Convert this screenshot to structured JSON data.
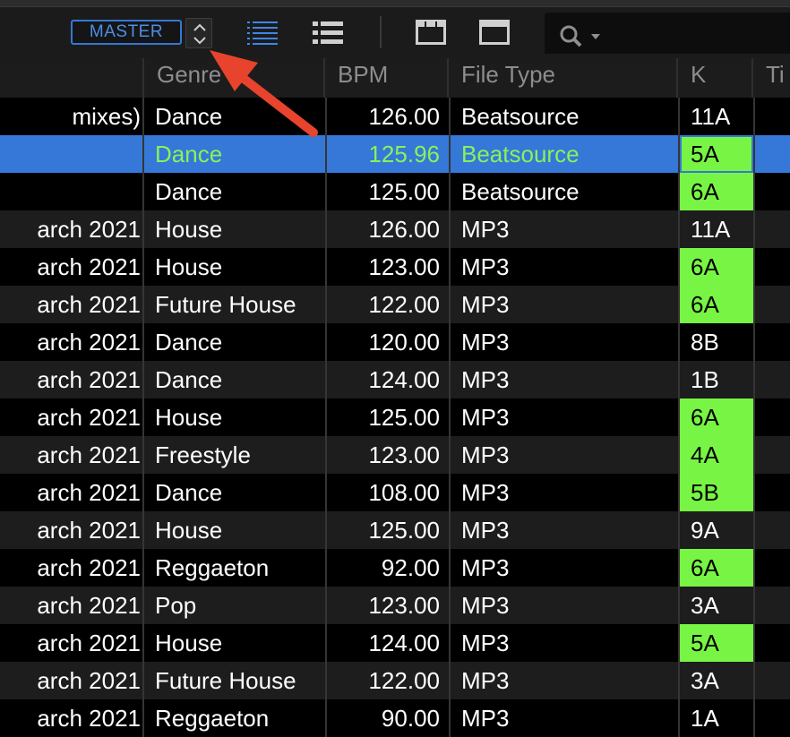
{
  "toolbar": {
    "master_label": "MASTER"
  },
  "columns": {
    "genre": "Genre",
    "bpm": "BPM",
    "file_type": "File Type",
    "key": "K",
    "time": "Ti"
  },
  "rows": [
    {
      "col0": "mixes)",
      "genre": "Dance",
      "bpm": "126.00",
      "type": "Beatsource",
      "key": "11A",
      "key_green": false,
      "selected": false
    },
    {
      "col0": "",
      "genre": "Dance",
      "bpm": "125.96",
      "type": "Beatsource",
      "key": "5A",
      "key_green": true,
      "selected": true
    },
    {
      "col0": "",
      "genre": "Dance",
      "bpm": "125.00",
      "type": "Beatsource",
      "key": "6A",
      "key_green": true,
      "selected": false
    },
    {
      "col0": "arch 2021",
      "genre": "House",
      "bpm": "126.00",
      "type": "MP3",
      "key": "11A",
      "key_green": false,
      "selected": false
    },
    {
      "col0": "arch 2021",
      "genre": "House",
      "bpm": "123.00",
      "type": "MP3",
      "key": "6A",
      "key_green": true,
      "selected": false
    },
    {
      "col0": "arch 2021",
      "genre": "Future House",
      "bpm": "122.00",
      "type": "MP3",
      "key": "6A",
      "key_green": true,
      "selected": false
    },
    {
      "col0": "arch 2021",
      "genre": "Dance",
      "bpm": "120.00",
      "type": "MP3",
      "key": "8B",
      "key_green": false,
      "selected": false
    },
    {
      "col0": "arch 2021",
      "genre": "Dance",
      "bpm": "124.00",
      "type": "MP3",
      "key": "1B",
      "key_green": false,
      "selected": false
    },
    {
      "col0": "arch 2021",
      "genre": "House",
      "bpm": "125.00",
      "type": "MP3",
      "key": "6A",
      "key_green": true,
      "selected": false
    },
    {
      "col0": "arch 2021",
      "genre": "Freestyle",
      "bpm": "123.00",
      "type": "MP3",
      "key": "4A",
      "key_green": true,
      "selected": false
    },
    {
      "col0": "arch 2021",
      "genre": "Dance",
      "bpm": "108.00",
      "type": "MP3",
      "key": "5B",
      "key_green": true,
      "selected": false
    },
    {
      "col0": "arch 2021",
      "genre": "House",
      "bpm": "125.00",
      "type": "MP3",
      "key": "9A",
      "key_green": false,
      "selected": false
    },
    {
      "col0": "arch 2021",
      "genre": "Reggaeton",
      "bpm": "92.00",
      "type": "MP3",
      "key": "6A",
      "key_green": true,
      "selected": false
    },
    {
      "col0": "arch 2021",
      "genre": "Pop",
      "bpm": "123.00",
      "type": "MP3",
      "key": "3A",
      "key_green": false,
      "selected": false
    },
    {
      "col0": "arch 2021",
      "genre": "House",
      "bpm": "124.00",
      "type": "MP3",
      "key": "5A",
      "key_green": true,
      "selected": false
    },
    {
      "col0": "arch 2021",
      "genre": "Future House",
      "bpm": "122.00",
      "type": "MP3",
      "key": "3A",
      "key_green": false,
      "selected": false
    },
    {
      "col0": "arch 2021",
      "genre": "Reggaeton",
      "bpm": "90.00",
      "type": "MP3",
      "key": "1A",
      "key_green": false,
      "selected": false
    }
  ],
  "colors": {
    "selection": "#3578d7",
    "key_green": "#78f544",
    "accent_blue": "#4c8fe8",
    "annotation_arrow": "#e8432d"
  }
}
